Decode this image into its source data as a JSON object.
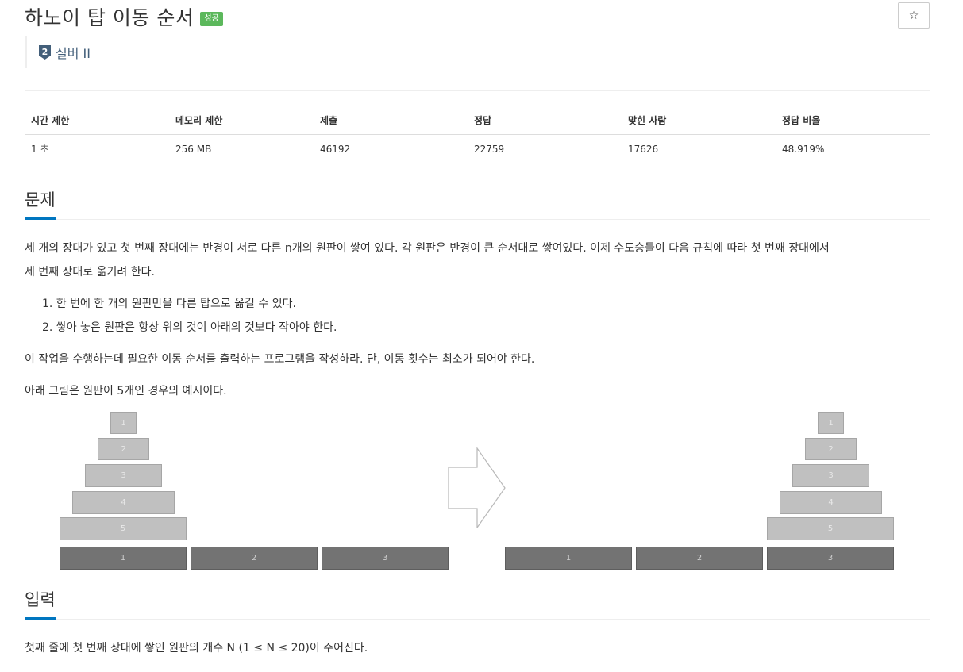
{
  "problem": {
    "title": "하노이 탑 이동 순서",
    "result_badge": "성공",
    "tier_number": "2",
    "tier_label": "실버 II",
    "star_label": "☆"
  },
  "info_table": {
    "headers": [
      "시간 제한",
      "메모리 제한",
      "제출",
      "정답",
      "맞힌 사람",
      "정답 비율"
    ],
    "values": [
      "1 초",
      "256 MB",
      "46192",
      "22759",
      "17626",
      "48.919%"
    ]
  },
  "description": {
    "heading": "문제",
    "paragraph1_line1": "세 개의 장대가 있고 첫 번째 장대에는 반경이 서로 다른 n개의 원판이 쌓여 있다. 각 원판은 반경이 큰 순서대로 쌓여있다. 이제 수도승들이 다음 규칙에 따라 첫 번째 장대에서",
    "paragraph1_line2": "세 번째 장대로 옮기려 한다.",
    "rules": [
      "1. 한 번에 한 개의 원판만을 다른 탑으로 옮길 수 있다.",
      "2. 쌓아 놓은 원판은 항상 위의 것이 아래의 것보다 작아야 한다."
    ],
    "paragraph2": "이 작업을 수행하는데 필요한 이동 순서를 출력하는 프로그램을 작성하라. 단, 이동 횟수는 최소가 되어야 한다.",
    "paragraph3": "아래 그림은 원판이 5개인 경우의 예시이다."
  },
  "figure": {
    "disk_labels": [
      "1",
      "2",
      "3",
      "4",
      "5"
    ],
    "peg_labels": [
      "1",
      "2",
      "3"
    ],
    "arrow_icon": "right-arrow-outline"
  },
  "input": {
    "heading": "입력",
    "text": "첫째 줄에 첫 번째 장대에 쌓인 원판의 개수 N (1 ≤ N ≤ 20)이 주어진다."
  }
}
